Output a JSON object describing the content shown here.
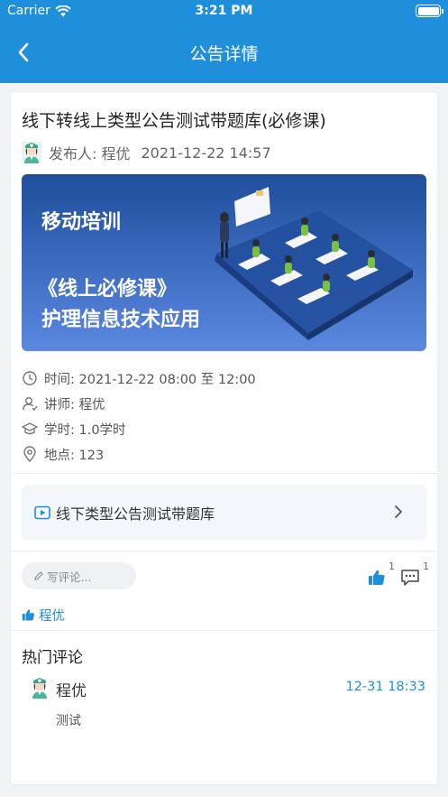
{
  "status_bar": {
    "carrier": "Carrier",
    "time": "3:21 PM"
  },
  "nav": {
    "title": "公告详情",
    "back_icon": "chevron-left-icon"
  },
  "post": {
    "title": "线下转线上类型公告测试带题库(必修课)",
    "author_label": "发布人: 程优",
    "published_at": "2021-12-22 14:57"
  },
  "banner": {
    "line1": "移动培训",
    "line2": "《线上必修课》",
    "line3": "护理信息技术应用",
    "bg_start": "#1f4e9c",
    "bg_end": "#5b88e0"
  },
  "details": [
    {
      "icon": "clock-icon",
      "text": "时间:  2021-12-22 08:00 至 12:00"
    },
    {
      "icon": "teacher-icon",
      "text": "讲师:  程优"
    },
    {
      "icon": "graduation-cap-icon",
      "text": "学时:  1.0学时"
    },
    {
      "icon": "location-pin-icon",
      "text": "地点:  123"
    }
  ],
  "question_bank": {
    "label": "线下类型公告测试带题库",
    "icon": "video-play-icon"
  },
  "actions": {
    "comment_placeholder": "写评论...",
    "like_count": "1",
    "comment_count": "1"
  },
  "likers": {
    "names": "程优"
  },
  "hot_comments": {
    "title": "热门评论",
    "items": [
      {
        "author": "程优",
        "time": "12-31 18:33",
        "text": "测试"
      }
    ]
  },
  "colors": {
    "primary": "#1f8fdc",
    "background": "#f2f3f5"
  }
}
